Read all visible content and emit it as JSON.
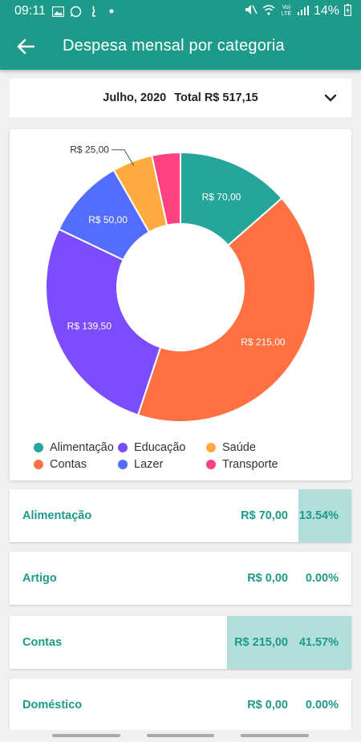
{
  "status_bar": {
    "time": "09:11",
    "battery": "14%",
    "network_label": "Vo) LTE"
  },
  "app_bar": {
    "title": "Despesa mensal por categoria"
  },
  "selector": {
    "month": "Julho, 2020",
    "total": "Total R$  517,15"
  },
  "chart_data": {
    "type": "pie",
    "donut": true,
    "categories": [
      "Alimentação",
      "Contas",
      "Educação",
      "Lazer",
      "Saúde",
      "Transporte"
    ],
    "values": [
      70.0,
      215.0,
      139.5,
      50.0,
      25.0,
      17.65
    ],
    "labels": [
      "R$  70,00",
      "R$  215,00",
      "R$  139,50",
      "R$  50,00",
      "R$  25,00",
      ""
    ],
    "colors": [
      "#26a69a",
      "#ff7043",
      "#7c4dff",
      "#536dfe",
      "#ffab40",
      "#ff4081"
    ],
    "legend_position": "bottom"
  },
  "legend": {
    "row1": [
      {
        "label": "Alimentação",
        "color": "#26a69a"
      },
      {
        "label": "Educação",
        "color": "#7c4dff"
      },
      {
        "label": "Saúde",
        "color": "#ffab40"
      }
    ],
    "row2": [
      {
        "label": "Contas",
        "color": "#ff7043"
      },
      {
        "label": "Lazer",
        "color": "#536dfe"
      },
      {
        "label": "Transporte",
        "color": "#ff4081"
      }
    ]
  },
  "list": [
    {
      "name": "Alimentação",
      "amount": "R$  70,00",
      "percent": "13.54%",
      "share": 13.54
    },
    {
      "name": "Artigo",
      "amount": "R$  0,00",
      "percent": "0.00%",
      "share": 0
    },
    {
      "name": "Contas",
      "amount": "R$  215,00",
      "percent": "41.57%",
      "share": 41.57
    },
    {
      "name": "Doméstico",
      "amount": "R$  0,00",
      "percent": "0.00%",
      "share": 0
    }
  ]
}
